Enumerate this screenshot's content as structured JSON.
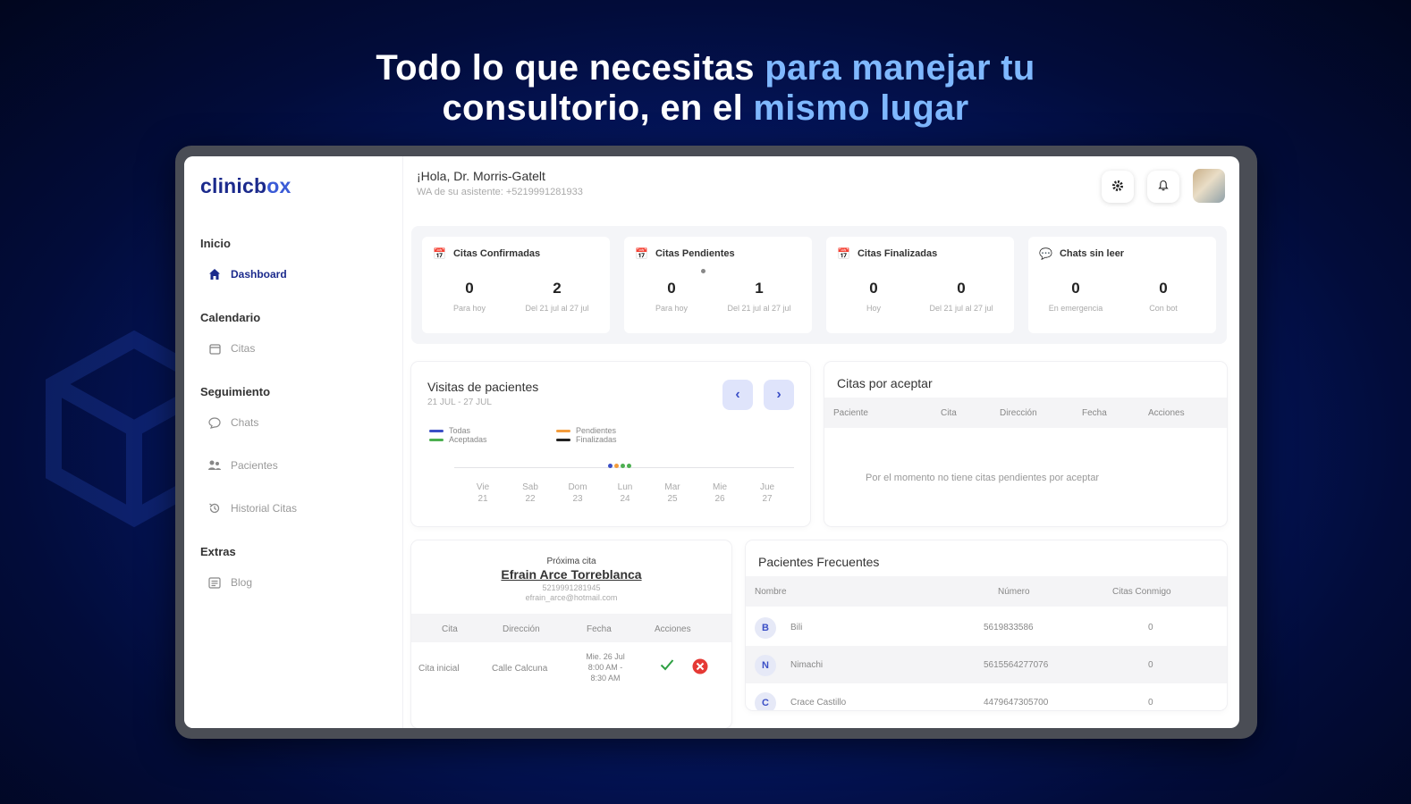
{
  "headline": {
    "line1_white": "Todo lo que necesitas ",
    "line1_accent": "para manejar tu",
    "line2_white": "consultorio, en el ",
    "line2_accent": "mismo lugar"
  },
  "app": {
    "logo_a": "clinicb",
    "logo_b": "ox",
    "greeting": "¡Hola, Dr. Morris-Gatelt",
    "greeting_sub": "WA de su asistente: +5219991281933"
  },
  "sidebar": {
    "sections": [
      {
        "title": "Inicio",
        "items": [
          {
            "label": "Dashboard",
            "icon": "home-icon"
          }
        ]
      },
      {
        "title": "Calendario",
        "items": [
          {
            "label": "Citas",
            "icon": "calendar-icon"
          }
        ]
      },
      {
        "title": "Seguimiento",
        "items": [
          {
            "label": "Chats",
            "icon": "chat-icon"
          },
          {
            "label": "Pacientes",
            "icon": "users-icon"
          },
          {
            "label": "Historial Citas",
            "icon": "history-icon"
          }
        ]
      },
      {
        "title": "Extras",
        "items": [
          {
            "label": "Blog",
            "icon": "blog-icon"
          }
        ]
      }
    ]
  },
  "topbar": {
    "settings_icon": "gear-icon",
    "bell_icon": "bell-icon"
  },
  "stats": [
    {
      "title": "Citas Confirmadas",
      "left_value": "0",
      "left_label": "Para hoy",
      "right_value": "2",
      "right_label": "Del 21 jul al 27 jul"
    },
    {
      "title": "Citas Pendientes",
      "left_value": "0",
      "left_label": "Para hoy",
      "right_value": "1",
      "right_label": "Del 21 jul al 27 jul"
    },
    {
      "title": "Citas Finalizadas",
      "left_value": "0",
      "left_label": "Hoy",
      "right_value": "0",
      "right_label": "Del 21 jul al 27 jul"
    },
    {
      "title": "Chats sin leer",
      "left_value": "0",
      "left_label": "En emergencia",
      "right_value": "0",
      "right_label": "Con bot"
    }
  ],
  "visits": {
    "title": "Visitas de pacientes",
    "range": "21 JUL - 27 JUL",
    "legend": [
      {
        "label": "Todas",
        "color": "#3b4fc6"
      },
      {
        "label": "Aceptadas",
        "color": "#4caf50"
      },
      {
        "label": "Pendientes",
        "color": "#f39c3c"
      },
      {
        "label": "Finalizadas",
        "color": "#222222"
      }
    ],
    "days": [
      {
        "d": "Vie",
        "n": "21"
      },
      {
        "d": "Sab",
        "n": "22"
      },
      {
        "d": "Dom",
        "n": "23"
      },
      {
        "d": "Lun",
        "n": "24"
      },
      {
        "d": "Mar",
        "n": "25"
      },
      {
        "d": "Mie",
        "n": "26"
      },
      {
        "d": "Jue",
        "n": "27"
      }
    ]
  },
  "pending": {
    "title": "Citas por aceptar",
    "columns": [
      "Paciente",
      "Cita",
      "Dirección",
      "Fecha",
      "Acciones"
    ],
    "empty": "Por el momento no tiene citas pendientes por aceptar"
  },
  "next": {
    "label": "Próxima cita",
    "name": "Efrain Arce Torreblanca",
    "phone": "5219991281945",
    "email": "efrain_arce@hotmail.com",
    "columns": [
      "Cita",
      "Dirección",
      "Fecha",
      "Acciones"
    ],
    "row": {
      "cita": "Cita inicial",
      "direccion": "Calle Calcuna",
      "fecha1": "Mie. 26 Jul",
      "fecha2": "8:00 AM -",
      "fecha3": "8:30 AM"
    }
  },
  "frequent": {
    "title": "Pacientes Frecuentes",
    "columns": [
      "Nombre",
      "Número",
      "Citas Conmigo"
    ],
    "rows": [
      {
        "initial": "B",
        "name": "Bili",
        "number": "5619833586",
        "count": "0"
      },
      {
        "initial": "N",
        "name": "Nimachi",
        "number": "5615564277076",
        "count": "0"
      },
      {
        "initial": "C",
        "name": "Crace Castillo",
        "number": "4479647305700",
        "count": "0"
      }
    ]
  }
}
